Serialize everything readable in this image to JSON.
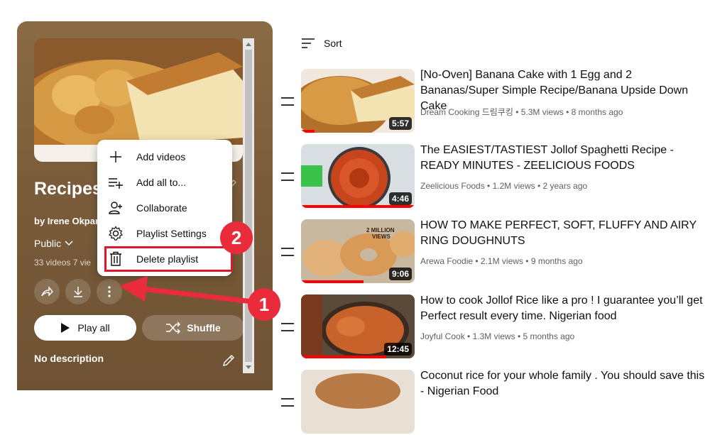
{
  "playlist": {
    "title": "Recipes",
    "owner": "by Irene Okpar",
    "privacy": "Public",
    "stats": "33 videos  7 vie",
    "play_all": "Play all",
    "shuffle": "Shuffle",
    "description": "No description"
  },
  "menu": {
    "items": [
      {
        "label": "Add videos",
        "icon": "plus-icon"
      },
      {
        "label": "Add all to...",
        "icon": "playlist-add-icon"
      },
      {
        "label": "Collaborate",
        "icon": "collaborate-icon"
      },
      {
        "label": "Playlist Settings",
        "icon": "gear-icon"
      },
      {
        "label": "Delete playlist",
        "icon": "trash-icon"
      }
    ]
  },
  "annotations": {
    "badge_1": "1",
    "badge_2": "2",
    "color": "#ea2b3b"
  },
  "sort": {
    "label": "Sort"
  },
  "videos": [
    {
      "title": "[No-Oven] Banana Cake with 1 Egg and 2 Bananas/Super Simple Recipe/Banana Upside Down Cake",
      "channel": "Dream Cooking 드림쿠킹",
      "views": "5.3M views",
      "age": "8 months ago",
      "duration": "5:57",
      "watched": 0.12
    },
    {
      "title": "The EASIEST/TASTIEST Jollof Spaghetti Recipe - READY MINUTES - ZEELICIOUS FOODS",
      "channel": "Zeelicious Foods",
      "views": "1.2M views",
      "age": "2 years ago",
      "duration": "4:46",
      "watched": 1.0
    },
    {
      "title": "HOW TO MAKE PERFECT, SOFT, FLUFFY AND AIRY RING DOUGHNUTS",
      "channel": "Arewa Foodie",
      "views": "2.1M views",
      "age": "9 months ago",
      "duration": "9:06",
      "watched": 0.55
    },
    {
      "title": "How to cook Jollof Rice like a pro ! I guarantee you’ll get Perfect result every time. Nigerian food",
      "channel": "Joyful Cook",
      "views": "1.3M views",
      "age": "5 months ago",
      "duration": "12:45",
      "watched": 0.75
    },
    {
      "title": "Coconut rice for your whole family . You should save this - Nigerian Food",
      "channel": "",
      "views": "",
      "age": "",
      "duration": "",
      "watched": 0
    }
  ]
}
